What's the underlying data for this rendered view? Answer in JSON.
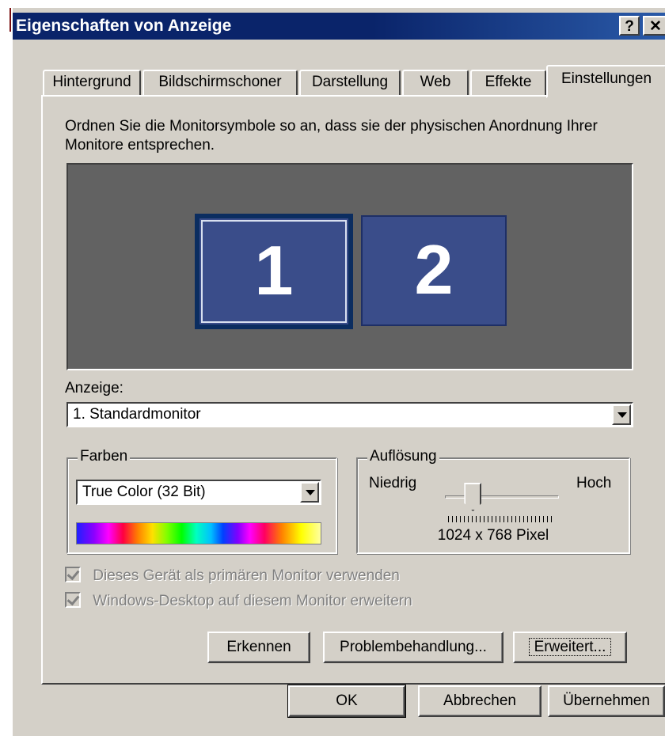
{
  "window": {
    "title": "Eigenschaften von Anzeige",
    "help_glyph": "?",
    "close_glyph": "✕"
  },
  "tabs": [
    {
      "label": "Hintergrund",
      "active": false
    },
    {
      "label": "Bildschirmschoner",
      "active": false
    },
    {
      "label": "Darstellung",
      "active": false
    },
    {
      "label": "Web",
      "active": false
    },
    {
      "label": "Effekte",
      "active": false
    },
    {
      "label": "Einstellungen",
      "active": true
    }
  ],
  "settings": {
    "description": "Ordnen Sie die Monitorsymbole so an, dass sie der physischen Anordnung Ihrer Monitore entsprechen.",
    "monitors": [
      {
        "label": "1",
        "selected": true
      },
      {
        "label": "2",
        "selected": false
      }
    ],
    "display_label": "Anzeige:",
    "display_value": "1. Standardmonitor",
    "colors": {
      "group_title": "Farben",
      "value": "True Color (32 Bit)"
    },
    "resolution": {
      "group_title": "Auflösung",
      "low_label": "Niedrig",
      "high_label": "Hoch",
      "value_text": "1024 x 768 Pixel",
      "slider_level": 0.2
    },
    "checkboxes": [
      {
        "label": "Dieses Gerät als primären Monitor verwenden",
        "checked": true,
        "enabled": false
      },
      {
        "label": "Windows-Desktop auf diesem Monitor erweitern",
        "checked": true,
        "enabled": false
      }
    ],
    "buttons": {
      "detect": "Erkennen",
      "troubleshoot": "Problembehandlung...",
      "advanced": "Erweitert..."
    }
  },
  "footer": {
    "ok": "OK",
    "cancel": "Abbrechen",
    "apply": "Übernehmen"
  },
  "colors": {
    "title_bar": "#0a246a",
    "face": "#d4d0c8",
    "preview_bg": "#626262",
    "monitor": "#3a4d8a"
  }
}
